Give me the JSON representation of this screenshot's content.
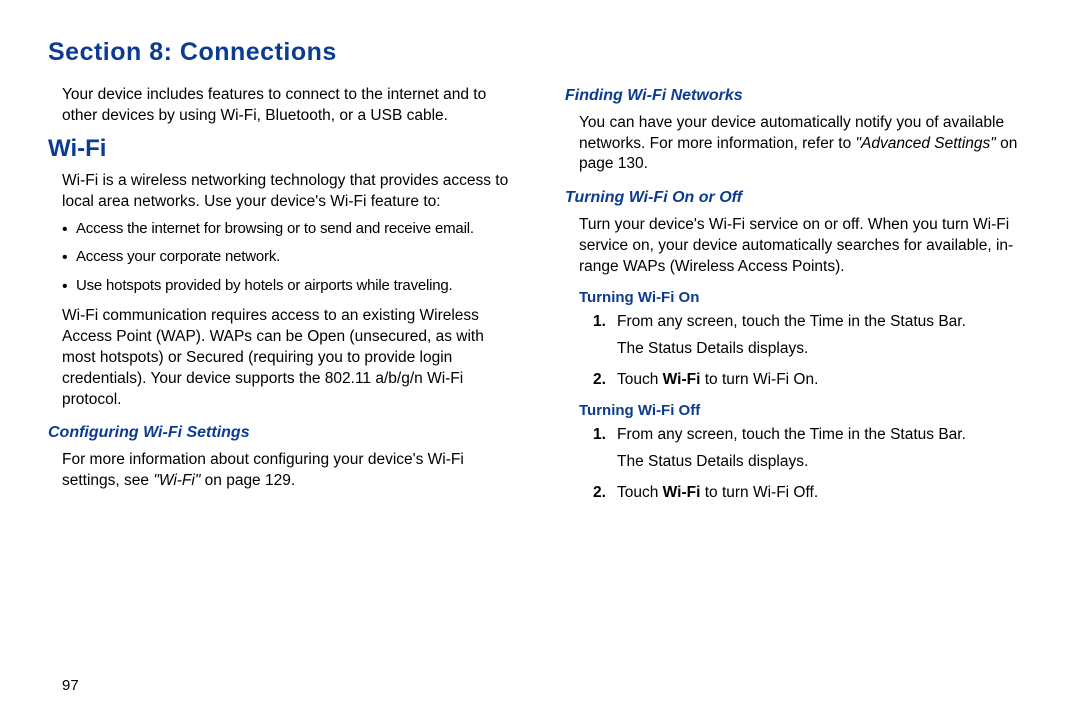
{
  "section_title": "Section 8: Connections",
  "page_number": "97",
  "left": {
    "intro": "Your device includes features to connect to the internet and to other devices by using Wi-Fi, Bluetooth, or a USB cable.",
    "wifi_heading": "Wi-Fi",
    "wifi_desc": "Wi-Fi is a wireless networking technology that provides access to local area networks. Use your device's Wi-Fi feature to:",
    "bullets": [
      "Access the internet for browsing or to send and receive email.",
      "Access your corporate network.",
      "Use hotspots provided by hotels or airports while traveling."
    ],
    "wap_para": "Wi-Fi communication requires access to an existing Wireless Access Point (WAP). WAPs can be Open (unsecured, as with most hotspots) or Secured (requiring you to provide login credentials). Your device supports the 802.11 a/b/g/n Wi-Fi protocol.",
    "config_heading": "Configuring Wi-Fi Settings",
    "config_text_a": "For more information about configuring your device's Wi-Fi settings, see ",
    "config_ref": "\"Wi-Fi\"",
    "config_text_b": " on page 129."
  },
  "right": {
    "finding_heading": "Finding Wi-Fi Networks",
    "finding_text_a": "You can have your device automatically notify you of available networks. For more information, refer to ",
    "finding_ref": "\"Advanced Settings\"",
    "finding_text_b": " on page 130.",
    "onoff_heading": "Turning Wi-Fi On or Off",
    "onoff_text": "Turn your device's Wi-Fi service on or off. When you turn Wi-Fi service on, your device automatically searches for available, in-range WAPs (Wireless Access Points).",
    "on_heading": "Turning Wi-Fi On",
    "on_steps": {
      "s1a": "From any screen, touch the Time in the Status Bar.",
      "s1b": "The Status Details displays.",
      "s2a": "Touch ",
      "s2bold": "Wi-Fi",
      "s2b": " to turn Wi-Fi On."
    },
    "off_heading": "Turning Wi-Fi Off",
    "off_steps": {
      "s1a": "From any screen, touch the Time in the Status Bar.",
      "s1b": "The Status Details displays.",
      "s2a": "Touch ",
      "s2bold": "Wi-Fi",
      "s2b": " to turn Wi-Fi Off."
    }
  }
}
